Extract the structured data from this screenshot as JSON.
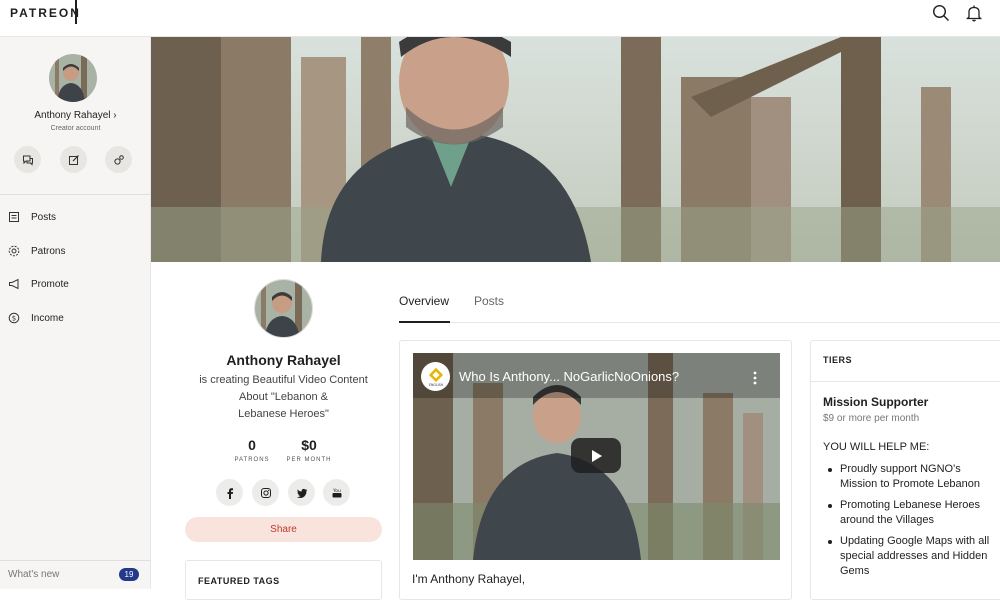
{
  "brand": {
    "logo_text": "PATREON"
  },
  "topbar": {
    "search_icon": "search-icon",
    "bell_icon": "bell-icon"
  },
  "sidebar": {
    "creator_name": "Anthony Rahayel",
    "creator_sub": "Creator account",
    "chevron": "›",
    "quick_actions": [
      "chat-icon",
      "edit-post-icon",
      "settings-icon"
    ],
    "items": [
      {
        "label": "Posts",
        "icon": "posts-icon"
      },
      {
        "label": "Patrons",
        "icon": "patrons-icon"
      },
      {
        "label": "Promote",
        "icon": "megaphone-icon"
      },
      {
        "label": "Income",
        "icon": "dollar-icon"
      }
    ],
    "whats_new": "What's new",
    "whats_new_count": "19"
  },
  "profile": {
    "name": "Anthony Rahayel",
    "description_line1": "is creating Beautiful Video Content",
    "description_line2": "About \"Lebanon &",
    "description_line3": "Lebanese Heroes\"",
    "patrons_value": "0",
    "patrons_label": "PATRONS",
    "per_month_value": "$0",
    "per_month_label": "PER MONTH",
    "social": [
      "facebook-icon",
      "instagram-icon",
      "twitter-icon",
      "youtube-icon"
    ],
    "share_label": "Share",
    "featured_tags_label": "FEATURED TAGS"
  },
  "tabs": [
    {
      "label": "Overview",
      "active": true
    },
    {
      "label": "Posts",
      "active": false
    }
  ],
  "video": {
    "title": "Who Is Anthony... NoGarlicNoOnions?",
    "channel_label": "ENGLISH",
    "intro_text": "I'm Anthony Rahayel,"
  },
  "tiers": {
    "heading": "TIERS",
    "tier_name": "Mission Supporter",
    "tier_price": "$9 or more per month",
    "help_heading": "YOU WILL HELP ME:",
    "benefits": [
      "Proudly support NGNO's Mission to Promote Lebanon",
      "Promoting Lebanese Heroes around the Villages",
      "Updating Google Maps with all special addresses and Hidden Gems"
    ]
  },
  "colors": {
    "accent_share_bg": "#f8e4dd",
    "accent_share_text": "#c0392b",
    "badge_bg": "#23398a"
  }
}
